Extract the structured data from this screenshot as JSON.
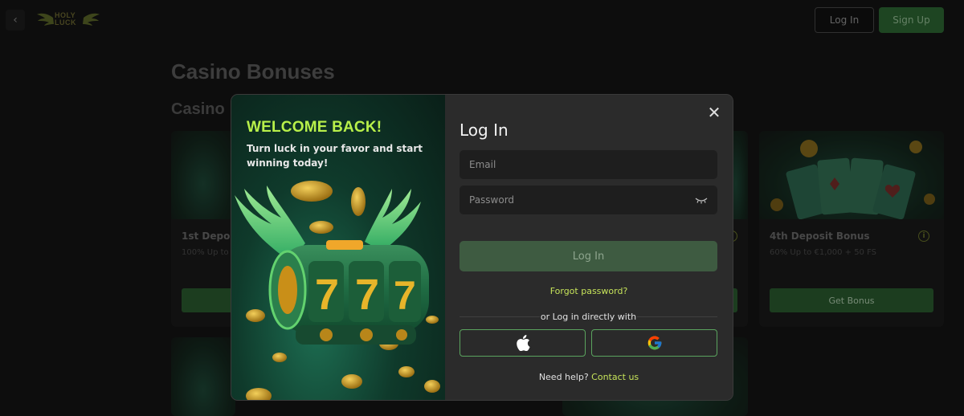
{
  "topbar": {
    "logo_text_line1": "HOLY",
    "logo_text_line2": "LUCK",
    "login_label": "Log In",
    "signup_label": "Sign Up"
  },
  "background": {
    "page_title": "Casino Bonuses",
    "section_title": "Casino",
    "cards": [
      {
        "title": "1st Depos",
        "subtitle": "100% Up to",
        "button": ""
      },
      {
        "title": "4th Deposit Bonus",
        "subtitle": "60% Up to €1,000 + 50 FS",
        "button": "Get Bonus"
      }
    ]
  },
  "modal": {
    "promo_title": "WELCOME BACK!",
    "promo_subtitle": "Turn luck in your favor and start winning today!",
    "form_title": "Log In",
    "email_placeholder": "Email",
    "password_placeholder": "Password",
    "login_button": "Log In",
    "forgot_password": "Forgot password?",
    "or_text": "or Log in directly with",
    "help_text": "Need help?",
    "help_link": "Contact us"
  },
  "icons": [
    "back-chevron-icon",
    "logo-wings-icon",
    "info-icon",
    "close-icon",
    "eye-closed-icon",
    "apple-icon",
    "google-icon"
  ],
  "colors": {
    "accent_green": "#2e6a35",
    "lime": "#c6e35a",
    "promo_title": "#b8f04a",
    "social_border": "#5aa45e"
  }
}
